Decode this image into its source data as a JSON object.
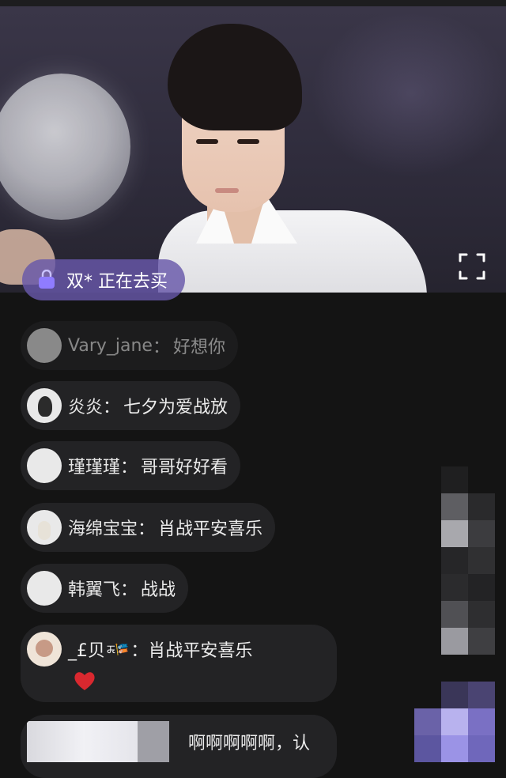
{
  "buying_notice": {
    "text": "双* 正在去买",
    "icon": "shopping-bag-icon"
  },
  "comments": [
    {
      "name": "Vary_jane",
      "message": "好想你"
    },
    {
      "name": "炎炎",
      "message": "七夕为爱战放"
    },
    {
      "name": "瑾瑾瑾",
      "message": "哥哥好好看"
    },
    {
      "name": "海绵宝宝",
      "message": "肖战平安喜乐"
    },
    {
      "name": "韩翼飞",
      "message": "战战"
    },
    {
      "name": "_£贝",
      "badges": "ꯘ🎏",
      "message": "肖战平安喜乐",
      "emoji": "heart"
    },
    {
      "name": "",
      "message": "啊啊啊啊啊，认"
    }
  ],
  "colors": {
    "pill": "#6858aa",
    "bubble": "#232325",
    "background": "#141414",
    "heart": "#d9282f"
  }
}
